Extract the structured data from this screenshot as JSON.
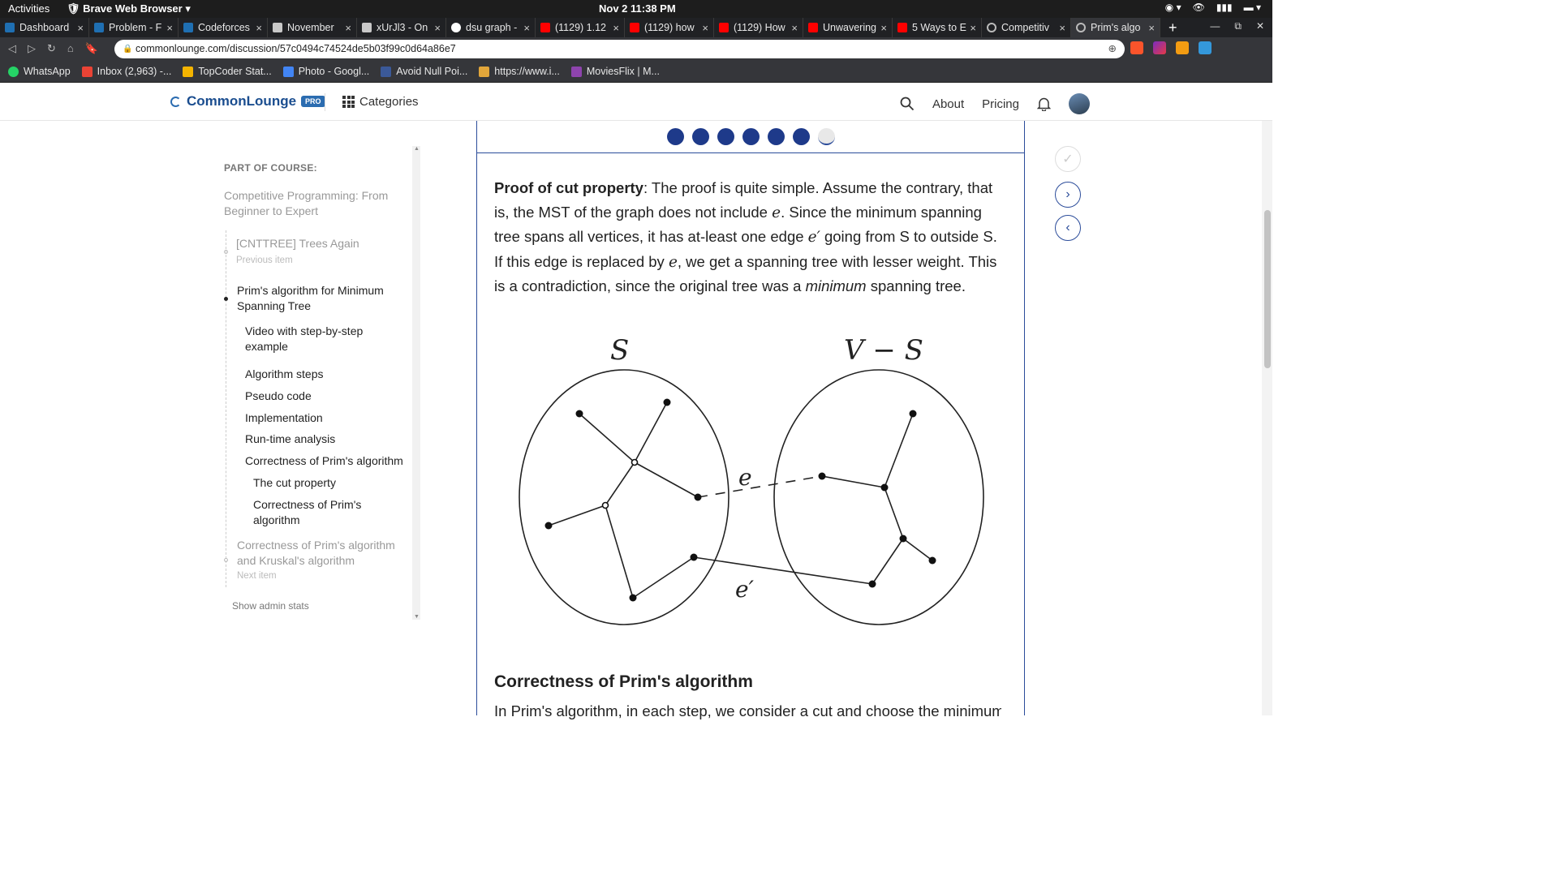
{
  "system": {
    "activities": "Activities",
    "app_name": "Brave Web Browser",
    "clock": "Nov 2  11:38 PM"
  },
  "tabs": [
    {
      "label": "Dashboard",
      "icon": "codeforces-icon"
    },
    {
      "label": "Problem - F",
      "icon": "codeforces-icon"
    },
    {
      "label": "Codeforces",
      "icon": "codeforces-icon"
    },
    {
      "label": "November",
      "icon": "codechef-icon"
    },
    {
      "label": "xUrJl3 - On",
      "icon": "page-icon"
    },
    {
      "label": "dsu graph -",
      "icon": "google-icon"
    },
    {
      "label": "(1129) 1.12",
      "icon": "youtube-icon"
    },
    {
      "label": "(1129) how",
      "icon": "youtube-icon"
    },
    {
      "label": "(1129) How",
      "icon": "youtube-icon"
    },
    {
      "label": "Unwavering",
      "icon": "youtube-icon"
    },
    {
      "label": "5 Ways to E",
      "icon": "youtube-icon"
    },
    {
      "label": "Competitiv",
      "icon": "loading-icon"
    },
    {
      "label": "Prim's algo",
      "icon": "loading-icon",
      "active": true
    }
  ],
  "address_bar": {
    "url": "commonlounge.com/discussion/57c0494c74524de5b03f99c0d64a86e7"
  },
  "bookmarks": [
    {
      "label": "WhatsApp",
      "color": "#25d366"
    },
    {
      "label": "Inbox (2,963) -...",
      "color": "#ea4335"
    },
    {
      "label": "TopCoder Stat...",
      "color": "#f4b400"
    },
    {
      "label": "Photo - Googl...",
      "color": "#4285f4"
    },
    {
      "label": "Avoid Null Poi...",
      "color": "#3b5998"
    },
    {
      "label": "https://www.i...",
      "color": "#e2a63a"
    },
    {
      "label": "MoviesFlix | M...",
      "color": "#8e44ad"
    }
  ],
  "site_header": {
    "logo": "CommonLounge",
    "pro_badge": "PRO",
    "categories": "Categories",
    "about": "About",
    "pricing": "Pricing"
  },
  "sidebar": {
    "part_of_course": "PART OF COURSE:",
    "course_title": "Competitive Programming: From Beginner to Expert",
    "previous_item": "[CNTTREE] Trees Again",
    "previous_label": "Previous item",
    "current_item": "Prim's algorithm for Minimum Spanning Tree",
    "sections": [
      "Video with step-by-step example",
      "Algorithm steps",
      "Pseudo code",
      "Implementation",
      "Run-time analysis",
      "Correctness of Prim's algorithm"
    ],
    "subsections": [
      "The cut property",
      "Correctness of Prim's algorithm"
    ],
    "next_item": "Correctness of Prim's algorithm and Kruskal's algorithm",
    "next_label": "Next item",
    "admin_stats": "Show admin stats"
  },
  "article": {
    "progress": {
      "completed": 6,
      "total": 7
    },
    "proof_heading": "Proof of cut property",
    "proof_p1": ": The proof is quite simple. Assume the contrary, that is, the MST of the graph does not include ",
    "var_e": "e",
    "proof_p2": ". Since the minimum spanning tree spans all vertices, it has at-least one edge ",
    "var_e_prime": "e′",
    "proof_p3": " going from S to outside S. If this edge is replaced by ",
    "proof_p4": ", we get a spanning tree with lesser weight. This is a contradiction, since the original tree was a ",
    "proof_emph": "minimum",
    "proof_p5": " spanning tree.",
    "figure": {
      "label_s": "S",
      "label_vs": "V − S",
      "label_e": "e",
      "label_e_prime": "e′"
    },
    "section_heading": "Correctness of Prim's algorithm",
    "section_text": "In Prim's algorithm, in each step, we consider a cut and choose the minimum"
  }
}
